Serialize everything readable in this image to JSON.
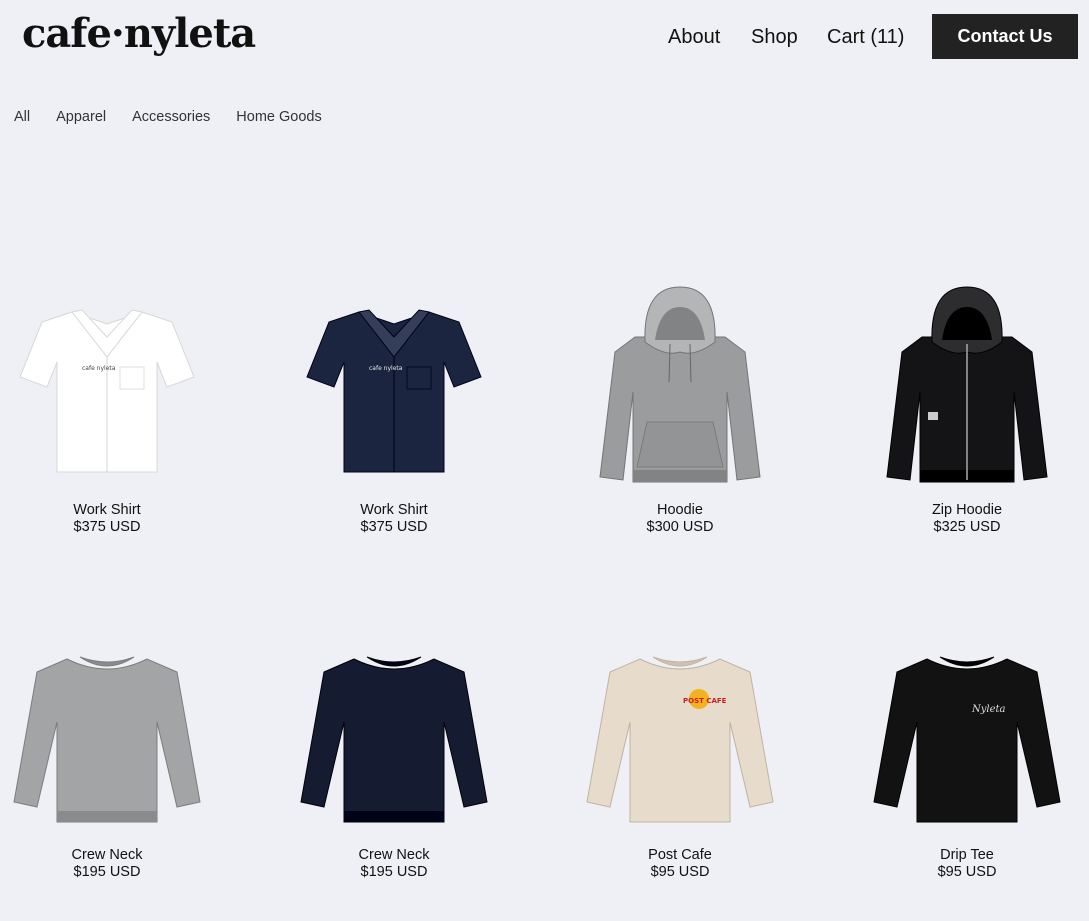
{
  "header": {
    "logo": "cafe·nyleta",
    "nav": [
      {
        "label": "About"
      },
      {
        "label": "Shop"
      },
      {
        "label": "Cart (11)"
      }
    ],
    "contact_label": "Contact Us"
  },
  "categories": [
    "All",
    "Apparel",
    "Accessories",
    "Home Goods"
  ],
  "products": [
    {
      "name": "Work Shirt",
      "price": "$375 USD",
      "type": "shirt",
      "color": "#ffffff",
      "print": "cafe nyleta"
    },
    {
      "name": "Work Shirt",
      "price": "$375 USD",
      "type": "shirt",
      "color": "#1c2540",
      "print": "cafe nyleta"
    },
    {
      "name": "Hoodie",
      "price": "$300 USD",
      "type": "hoodie",
      "color": "#9a9c9e"
    },
    {
      "name": "Zip Hoodie",
      "price": "$325 USD",
      "type": "zip-hoodie",
      "color": "#141416"
    },
    {
      "name": "Crew Neck",
      "price": "$195 USD",
      "type": "crew",
      "color": "#a3a4a6"
    },
    {
      "name": "Crew Neck",
      "price": "$195 USD",
      "type": "crew",
      "color": "#151b30"
    },
    {
      "name": "Post Cafe",
      "price": "$95 USD",
      "type": "longsleeve",
      "color": "#e7dccb",
      "print": "POST CAFE"
    },
    {
      "name": "Drip Tee",
      "price": "$95 USD",
      "type": "longsleeve",
      "color": "#121212",
      "print": "Nyleta"
    }
  ]
}
